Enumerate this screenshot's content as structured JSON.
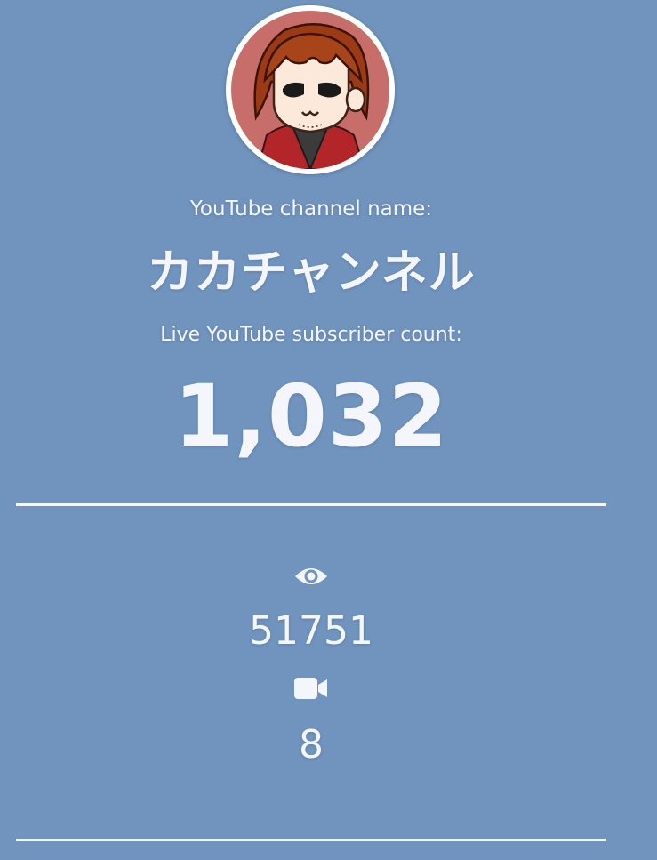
{
  "channel_label": "YouTube channel name:",
  "channel_name": "カカチャンネル",
  "subscriber_label": "Live YouTube subscriber count:",
  "subscriber_count": "1,032",
  "stats": {
    "views_icon": "eye-icon",
    "views": "51751",
    "videos_icon": "video-camera-icon",
    "videos": "8"
  },
  "colors": {
    "background": "#7094be",
    "text": "#f4f6fb",
    "avatar_ring": "#ffffff"
  }
}
